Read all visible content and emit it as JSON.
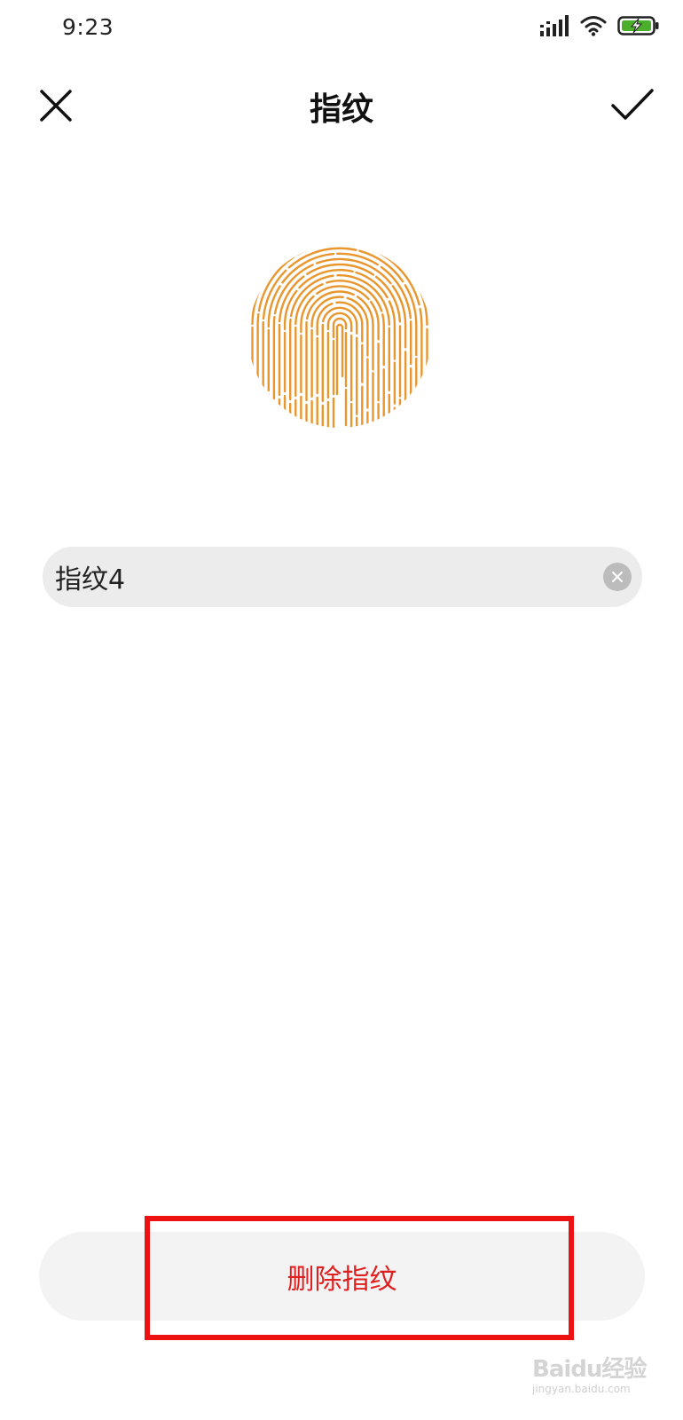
{
  "status_bar": {
    "time": "9:23",
    "icons": [
      "signal-icon",
      "wifi-icon",
      "battery-charging-icon"
    ],
    "battery_color": "#4caf2c"
  },
  "header": {
    "title": "指纹",
    "close_icon": "close-icon",
    "confirm_icon": "checkmark-icon"
  },
  "fingerprint": {
    "icon": "fingerprint-icon",
    "color": "#e8962d"
  },
  "name_field": {
    "value": "指纹4",
    "clear_icon": "clear-icon"
  },
  "delete_button": {
    "label": "删除指纹",
    "color": "#e02020"
  },
  "annotation": {
    "highlight_color": "#ee1111"
  },
  "watermark": {
    "main": "Baidu经验",
    "sub": "jingyan.baidu.com"
  }
}
